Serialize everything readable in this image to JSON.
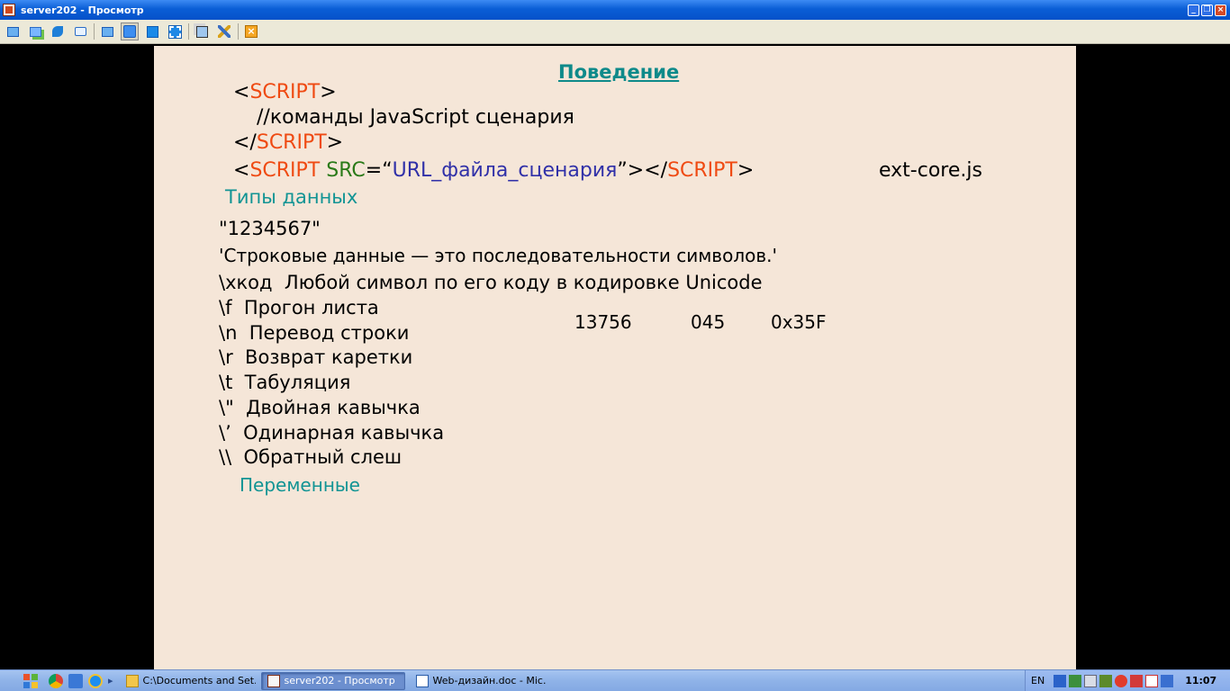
{
  "window": {
    "title": "server202 - Просмотр"
  },
  "slide": {
    "heading": "Поведение",
    "code_open_lt": "<",
    "code_open_tag": "SCRIPT",
    "code_open_gt": ">",
    "code_comment": "//команды JavaScript сценария",
    "code_close_lt": "</",
    "code_close_tag": "SCRIPT",
    "code_close_gt": ">",
    "src_lt": "<",
    "src_tag": "SCRIPT",
    "src_attr": "SRC",
    "src_eq": "=“",
    "src_value": "URL_файла_сценария",
    "src_close": "”></",
    "src_end_tag": "SCRIPT",
    "src_gt": ">",
    "src_example": "ext-core.js",
    "types_heading": "Типы данных",
    "string_example": "\"1234567\"",
    "string_def": "'Строковые данные — это последовательности символов.'",
    "escapes": [
      "\\xкод  Любой символ по его коду в кодировке Unicode",
      "\\f  Прогон листа",
      "\\n  Перевод строки",
      "\\r  Возврат каретки",
      "\\t  Табуляция",
      "\\\"  Двойная кавычка",
      "\\’  Одинарная кавычка",
      "\\\\  Обратный слеш"
    ],
    "numbers": [
      "13756",
      "045",
      "0x35F"
    ],
    "variables_heading": "Переменные"
  },
  "taskbar": {
    "tasks": [
      "C:\\Documents and Set...",
      "server202 - Просмотр",
      "Web-дизайн.doc - Mic..."
    ],
    "language": "EN",
    "clock": "11:07"
  },
  "colors": {
    "slide_bg": "#f5e6d8",
    "tag_red": "#ef4a12",
    "attr_green": "#2a7a18",
    "value_blue": "#3030a8",
    "teal": "#119494"
  }
}
